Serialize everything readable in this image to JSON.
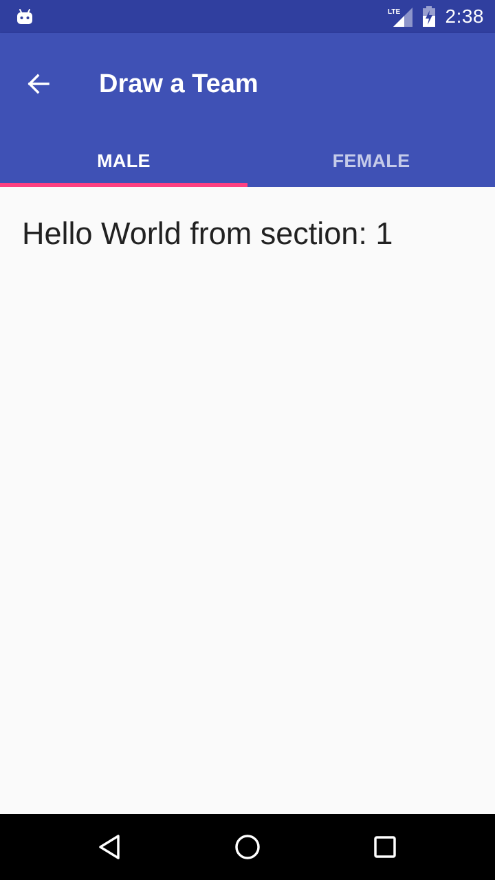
{
  "status_bar": {
    "notification_icon": "android-robot-icon",
    "network_label": "LTE",
    "battery_icon": "battery-charging-icon",
    "time": "2:38"
  },
  "toolbar": {
    "back_icon": "arrow-back-icon",
    "title": "Draw a Team"
  },
  "tabs": [
    {
      "label": "MALE",
      "selected": true
    },
    {
      "label": "FEMALE",
      "selected": false
    }
  ],
  "content": {
    "section_text": "Hello World from section: 1"
  },
  "nav_bar": {
    "back_icon": "triangle-back-icon",
    "home_icon": "circle-home-icon",
    "recents_icon": "square-recents-icon"
  },
  "colors": {
    "status_bar": "#303f9f",
    "primary": "#3f51b5",
    "accent": "#ff4081",
    "background": "#fafafa",
    "text": "#212121"
  }
}
